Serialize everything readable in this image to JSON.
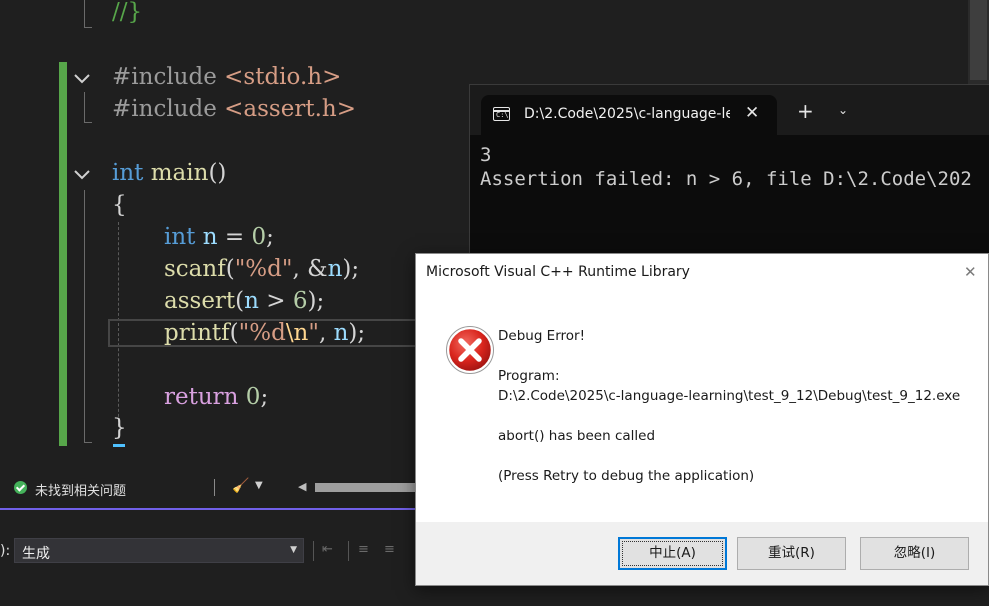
{
  "editor": {
    "lines": [
      [
        {
          "t": "//}",
          "c": "cm"
        }
      ],
      [
        {
          "t": "#include ",
          "c": "pp"
        },
        {
          "t": "<stdio.h>",
          "c": "str"
        }
      ],
      [
        {
          "t": "#include ",
          "c": "pp"
        },
        {
          "t": "<assert.h>",
          "c": "str"
        }
      ],
      [
        {
          "t": "int",
          "c": "kw"
        },
        {
          "t": " ",
          "c": ""
        },
        {
          "t": "main",
          "c": "fn"
        },
        {
          "t": "()",
          "c": ""
        }
      ],
      [
        {
          "t": "{",
          "c": ""
        }
      ],
      [
        {
          "t": "int",
          "c": "kw"
        },
        {
          "t": " ",
          "c": ""
        },
        {
          "t": "n",
          "c": "var"
        },
        {
          "t": " = ",
          "c": ""
        },
        {
          "t": "0",
          "c": "num"
        },
        {
          "t": ";",
          "c": ""
        }
      ],
      [
        {
          "t": "scanf",
          "c": "fn"
        },
        {
          "t": "(",
          "c": ""
        },
        {
          "t": "\"%d\"",
          "c": "str"
        },
        {
          "t": ", &",
          "c": ""
        },
        {
          "t": "n",
          "c": "var"
        },
        {
          "t": ");",
          "c": ""
        }
      ],
      [
        {
          "t": "assert",
          "c": "fn"
        },
        {
          "t": "(",
          "c": ""
        },
        {
          "t": "n",
          "c": "var"
        },
        {
          "t": " > ",
          "c": ""
        },
        {
          "t": "6",
          "c": "num"
        },
        {
          "t": ");",
          "c": ""
        }
      ],
      [
        {
          "t": "printf",
          "c": "fn"
        },
        {
          "t": "(",
          "c": ""
        },
        {
          "t": "\"%d",
          "c": "str"
        },
        {
          "t": "\\n",
          "c": "esc"
        },
        {
          "t": "\"",
          "c": "str"
        },
        {
          "t": ", ",
          "c": ""
        },
        {
          "t": "n",
          "c": "var"
        },
        {
          "t": ");",
          "c": ""
        }
      ],
      [
        {
          "t": "return",
          "c": "ret"
        },
        {
          "t": " ",
          "c": ""
        },
        {
          "t": "0",
          "c": "num"
        },
        {
          "t": ";",
          "c": ""
        }
      ],
      [
        {
          "t": "}",
          "c": ""
        }
      ]
    ]
  },
  "status": {
    "issues_label": "未找到相关问题",
    "brush_icon": "cleanup-brush-icon"
  },
  "output": {
    "source_label": "):",
    "source_value": "生成"
  },
  "terminal": {
    "tab_title": "D:\\2.Code\\2025\\c-language-le",
    "new_tab": "+",
    "lines": [
      "3",
      "Assertion failed: n > 6, file D:\\2.Code\\202"
    ]
  },
  "dialog": {
    "title": "Microsoft Visual C++ Runtime Library",
    "heading": "Debug Error!",
    "program_label": "Program:",
    "program_path": "D:\\2.Code\\2025\\c-language-learning\\test_9_12\\Debug\\test_9_12.exe",
    "message": "abort() has been called",
    "hint": "(Press Retry to debug the application)",
    "buttons": {
      "abort": "中止(A)",
      "retry": "重试(R)",
      "ignore": "忽略(I)"
    }
  },
  "colors": {
    "accent": "#7160e8",
    "change_bar": "#57a64a",
    "error_red": "#d9251d"
  }
}
